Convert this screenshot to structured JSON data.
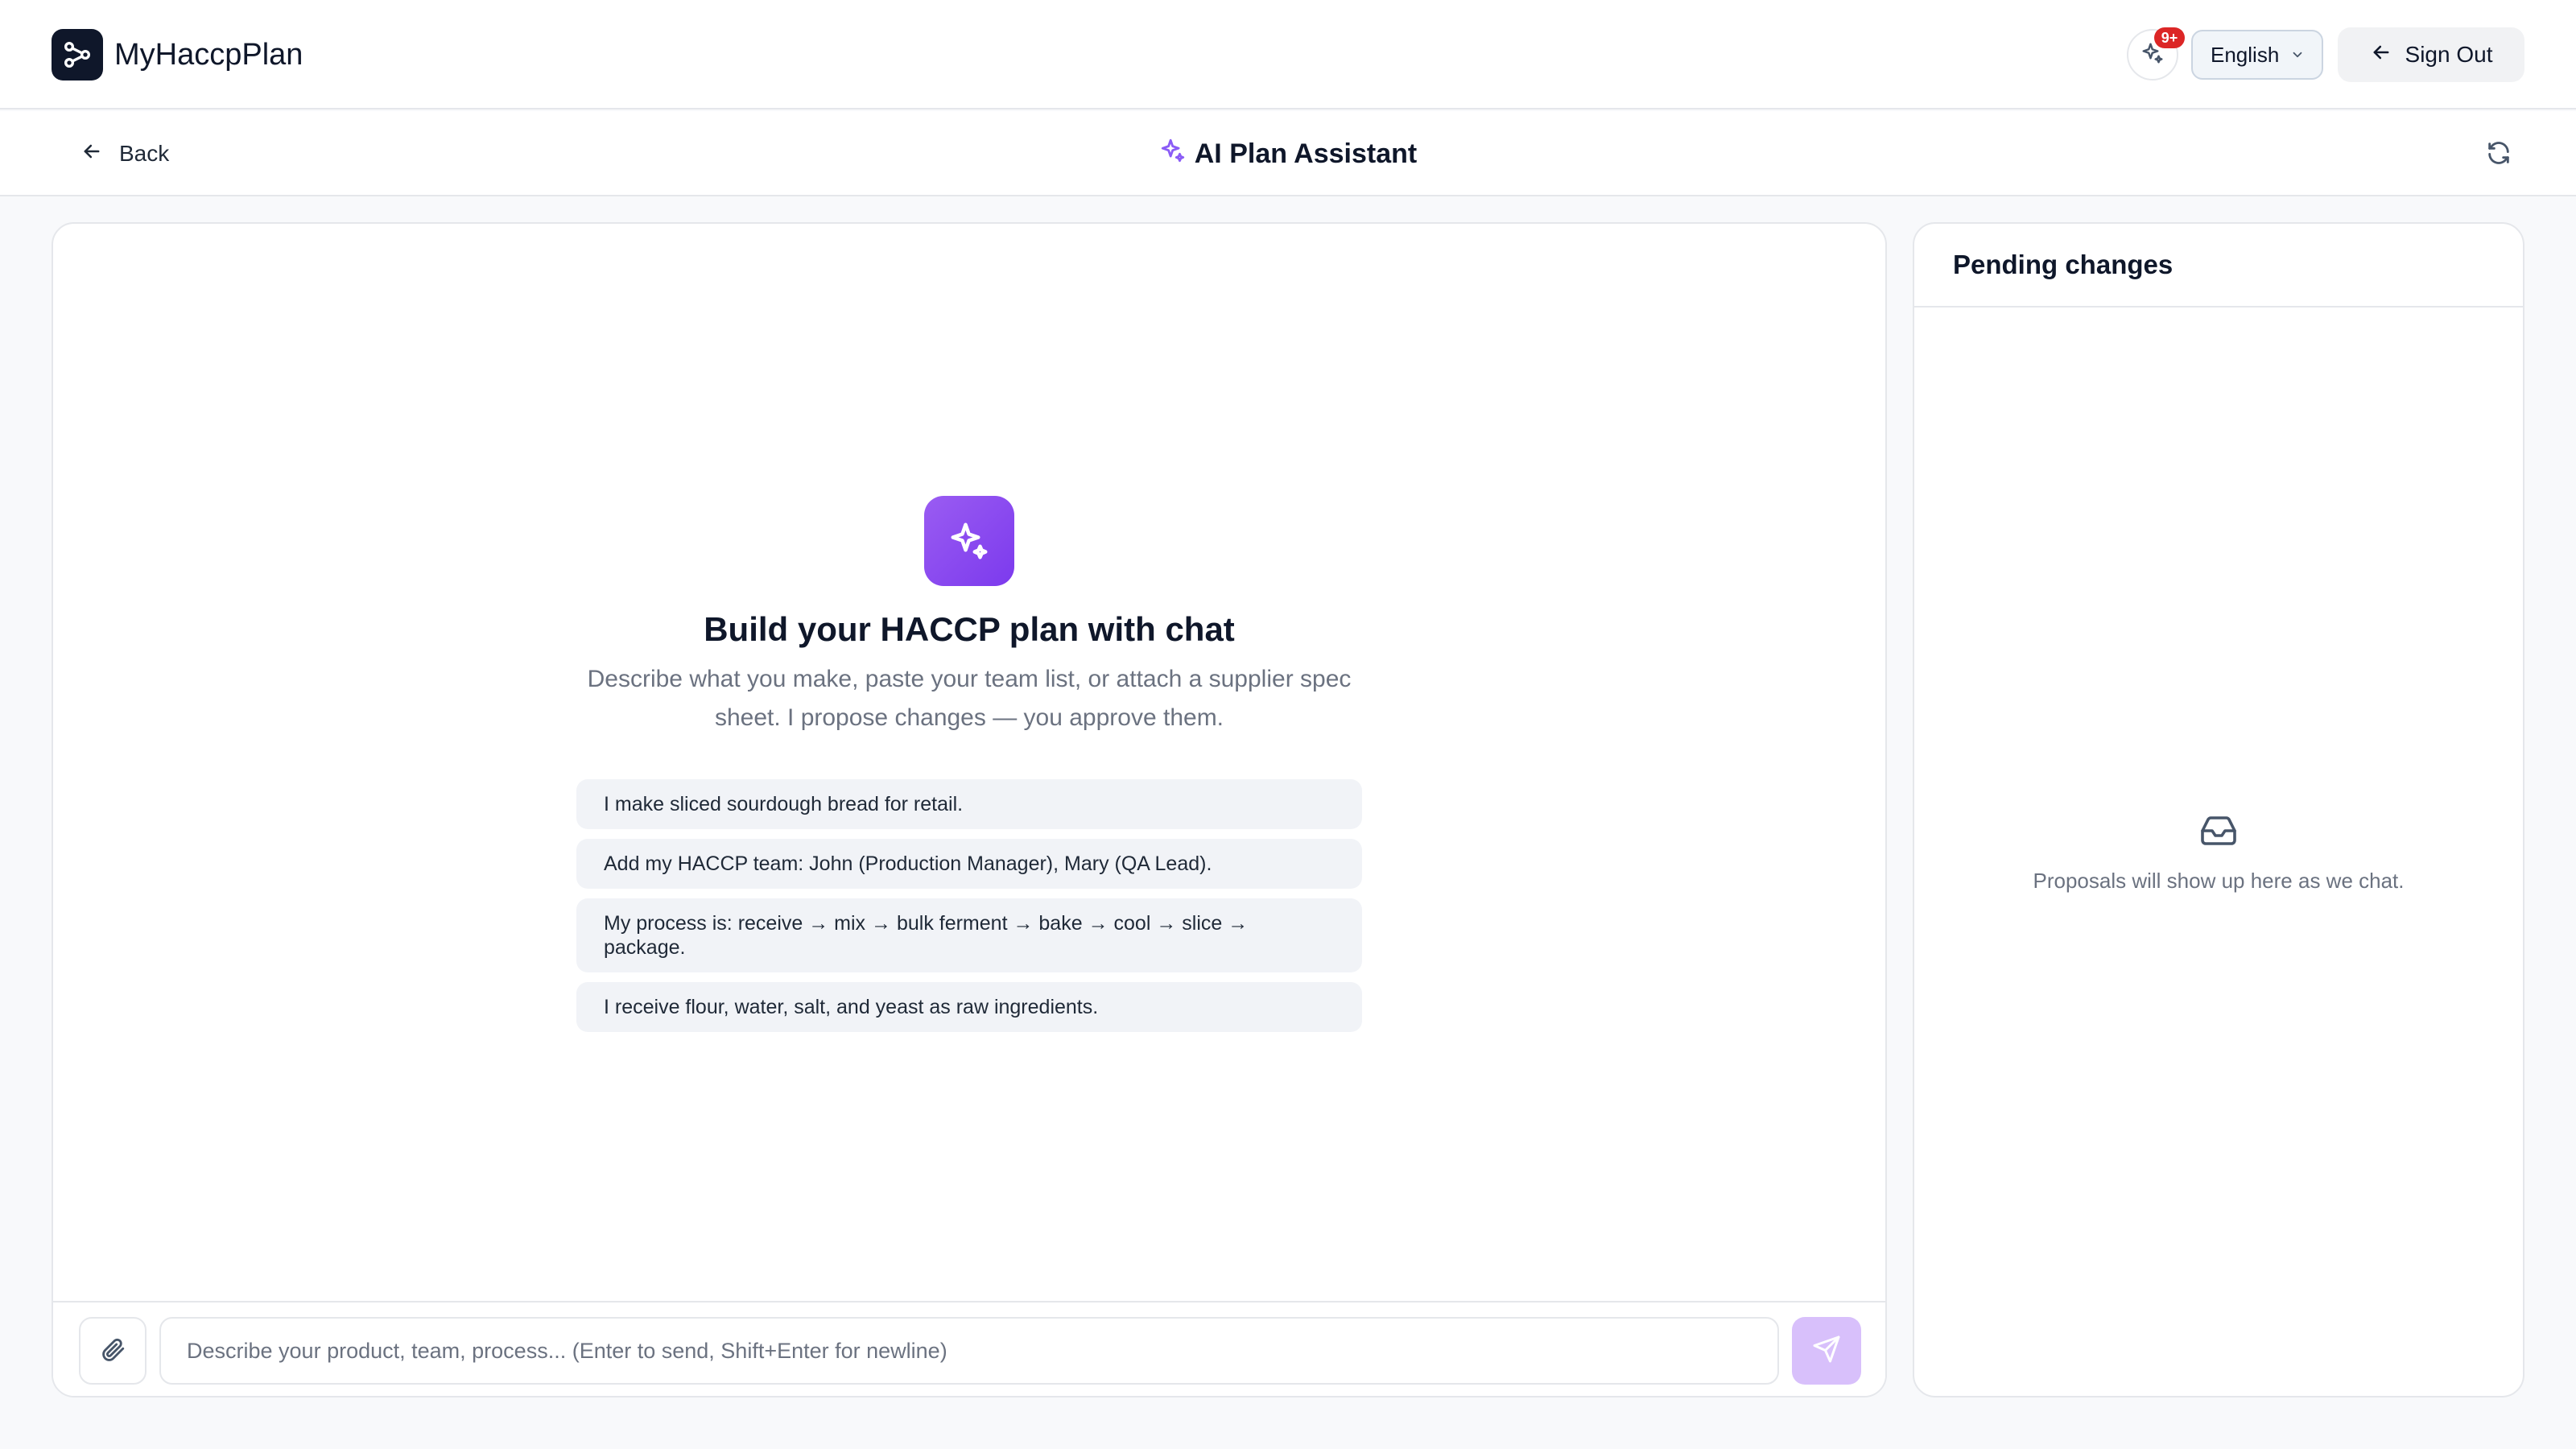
{
  "app": {
    "name": "MyHaccpPlan"
  },
  "header": {
    "ai_badge_count": "9+",
    "language": "English",
    "sign_out_label": "Sign Out"
  },
  "subheader": {
    "back_label": "Back",
    "title": "AI Plan Assistant"
  },
  "chat": {
    "empty_title": "Build your HACCP plan with chat",
    "empty_desc": "Describe what you make, paste your team list, or attach a supplier spec sheet. I propose changes — you approve them.",
    "suggestions": [
      "I make sliced sourdough bread for retail.",
      "Add my HACCP team: John (Production Manager), Mary (QA Lead).",
      "My process is: receive → mix → bulk ferment → bake → cool → slice → package.",
      "I receive flour, water, salt, and yeast as raw ingredients."
    ],
    "input_placeholder": "Describe your product, team, process... (Enter to send, Shift+Enter for newline)",
    "input_value": ""
  },
  "pending": {
    "title": "Pending changes",
    "empty_text": "Proposals will show up here as we chat."
  },
  "colors": {
    "accent": "#7c3aed",
    "accent_light": "#d8c0fb",
    "badge_red": "#dc2626",
    "brand_dark": "#0f172a"
  },
  "icons": {
    "logo": "workflow-nodes-icon",
    "ai_badge": "sparkles-icon",
    "language": "chevron-down-icon",
    "sign_out": "arrow-left-icon",
    "back": "arrow-left-icon",
    "title": "sparkles-icon",
    "refresh": "refresh-icon",
    "hero": "sparkles-icon",
    "attach": "paperclip-icon",
    "send": "send-icon",
    "pending_empty": "inbox-icon"
  }
}
